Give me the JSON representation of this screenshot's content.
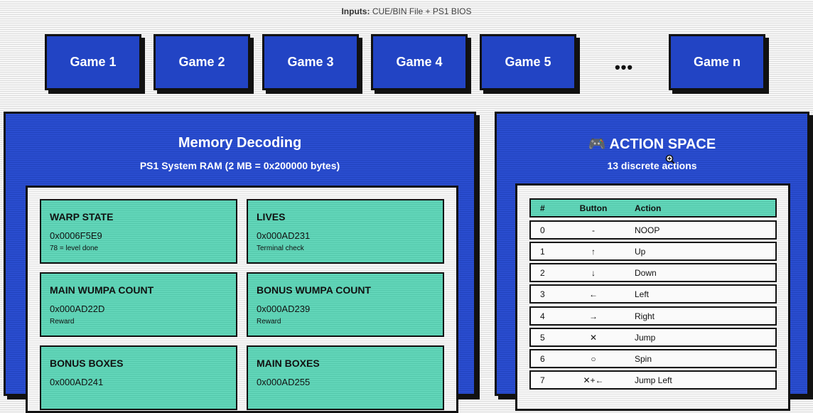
{
  "inputs": {
    "label": "Inputs:",
    "value": "CUE/BIN File + PS1 BIOS"
  },
  "games": [
    "Game 1",
    "Game 2",
    "Game 3",
    "Game 4",
    "Game 5",
    "Game n"
  ],
  "ellipsis": "•••",
  "memory": {
    "title": "Memory Decoding",
    "subtitle": "PS1 System RAM (2 MB = 0x200000 bytes)",
    "cards": [
      {
        "title": "WARP STATE",
        "address": "0x0006F5E9",
        "note": "78 = level done"
      },
      {
        "title": "LIVES",
        "address": "0x000AD231",
        "note": "Terminal check"
      },
      {
        "title": "MAIN WUMPA COUNT",
        "address": "0x000AD22D",
        "note": "Reward"
      },
      {
        "title": "BONUS WUMPA COUNT",
        "address": "0x000AD239",
        "note": "Reward"
      },
      {
        "title": "BONUS BOXES",
        "address": "0x000AD241",
        "note": ""
      },
      {
        "title": "MAIN BOXES",
        "address": "0x000AD255",
        "note": ""
      }
    ]
  },
  "actions": {
    "icon": "gamepad-icon",
    "icon_glyph": "🎮",
    "title": "ACTION SPACE",
    "subtitle": "13 discrete actions",
    "headers": [
      "#",
      "Button",
      "Action"
    ],
    "rows": [
      [
        "0",
        "-",
        "NOOP"
      ],
      [
        "1",
        "↑",
        "Up"
      ],
      [
        "2",
        "↓",
        "Down"
      ],
      [
        "3",
        "←",
        "Left"
      ],
      [
        "4",
        "→",
        "Right"
      ],
      [
        "5",
        "✕",
        "Jump"
      ],
      [
        "6",
        "○",
        "Spin"
      ],
      [
        "7",
        "✕+←",
        "Jump Left"
      ]
    ]
  },
  "colors": {
    "panel": "#2648c8",
    "card": "#5fd3b6",
    "border": "#111111"
  }
}
